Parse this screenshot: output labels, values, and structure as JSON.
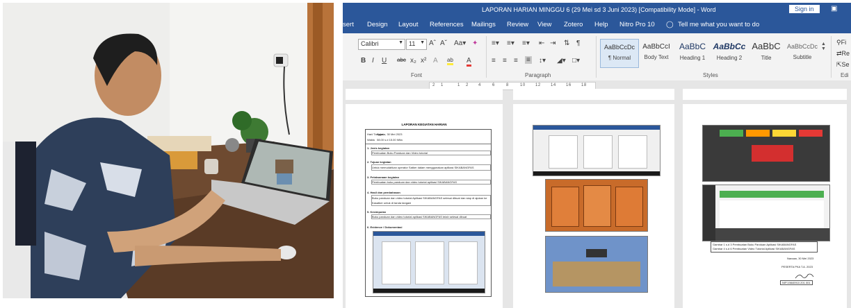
{
  "titlebar": {
    "title": "LAPORAN HARIAN MINGGU 6 (29 Mei sd 3 Juni 2023) [Compatibility Mode]  -  Word",
    "sign_in": "Sign in"
  },
  "tabs": [
    "sert",
    "Design",
    "Layout",
    "References",
    "Mailings",
    "Review",
    "View",
    "Zotero",
    "Help",
    "Nitro Pro 10"
  ],
  "tell_me": "Tell me what you want to do",
  "ribbon": {
    "font_name": "Calibri",
    "font_size": "11",
    "group_font": "Font",
    "group_paragraph": "Paragraph",
    "group_styles": "Styles",
    "styles": [
      {
        "preview": "AaBbCcDc",
        "name": "¶ Normal"
      },
      {
        "preview": "AaBbCcI",
        "name": "Body Text"
      },
      {
        "preview": "AaBbC",
        "name": "Heading 1"
      },
      {
        "preview": "AaBbCc",
        "name": "Heading 2"
      },
      {
        "preview": "AaBbC",
        "name": "Title"
      },
      {
        "preview": "AaBbCcDc",
        "name": "Subtitle"
      }
    ],
    "editing_short": "Edi",
    "right_items": [
      "Fi",
      "Re",
      "Se"
    ]
  },
  "ruler_marks": [
    "2",
    "1",
    "1",
    "2",
    "4",
    "6",
    "8",
    "10",
    "12",
    "14",
    "16",
    "18"
  ],
  "doc": {
    "page1": {
      "title": "LAPORAN KEGIATAN HARIAN",
      "rows": [
        {
          "label": "Hari/ Tanggal",
          "value": "Selasa, 30 Mei 2023"
        },
        {
          "label": "Waktu",
          "value": "08.00 s.d 15.00 Wita"
        }
      ],
      "sections": [
        {
          "head": "1.  Jenis kegiatan",
          "body": "Pembuatan Buku Panduan dan Video tutorial"
        },
        {
          "head": "2.  Tujuan kegiatan",
          "body": "Untuk memudahkan operator Satker dalam menggunakan aplikasi SIKABANGFAS"
        },
        {
          "head": "3.  Pelaksanaan kegiatan",
          "body": "Pembuatan buku panduan dan video tutorial aplikasi SIKABANGFAS"
        },
        {
          "head": "4.  Hasil dan pembahasan",
          "body": "Buku panduan dan video tutorial Aplikasi SIKABANGFAS selesai dibuat dan siap di ajukan ke Kasatker untuk di tanda tangani"
        },
        {
          "head": "5.  Kesimpulan",
          "body": "Buku panduan dan video tutorial aplikasi SIKABANGFAS telah selesai dibuat"
        },
        {
          "head": "6.  Evidence / Dokumentasi",
          "body": ""
        }
      ]
    },
    "page3": {
      "captions": [
        "Gambar 1 s.d 3 Pembuatan Buku Panduan  Aplikasi SIKABANGFAS",
        "Gambar 4 s.d 6 Pembuatan Video Tutorial  Aplikasi SIKABANGFAS"
      ],
      "place_date": "Nanaan, 30 Mei 2023",
      "signer_title": "PESERTA PKA T.A. 2023",
      "signer_nip": "NIP.19840910 201 001"
    }
  }
}
